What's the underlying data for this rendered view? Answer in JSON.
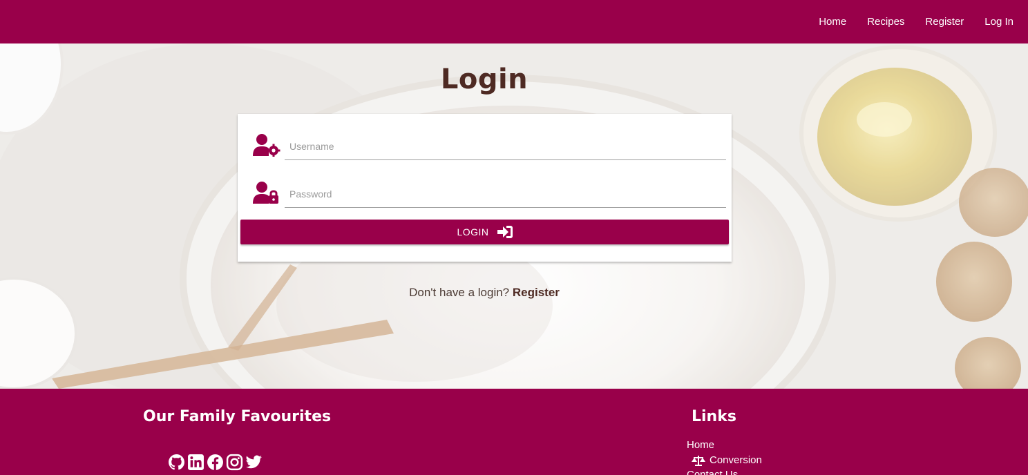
{
  "nav": {
    "items": [
      "Home",
      "Recipes",
      "Register",
      "Log In"
    ]
  },
  "main": {
    "title": "Login",
    "username_placeholder": "Username",
    "password_placeholder": "Password",
    "login_button": "LOGIN",
    "no_login_text": "Don't have a login?",
    "register_link": "Register"
  },
  "footer": {
    "left_title": "Our Family Favourites",
    "right_title": "Links",
    "social_icons": [
      "github-icon",
      "linkedin-icon",
      "facebook-icon",
      "instagram-icon",
      "twitter-icon"
    ],
    "links": [
      "Home",
      "Conversion",
      "Contact Us"
    ]
  },
  "colors": {
    "brand": "#99004a",
    "title_text": "#4e2a23"
  }
}
